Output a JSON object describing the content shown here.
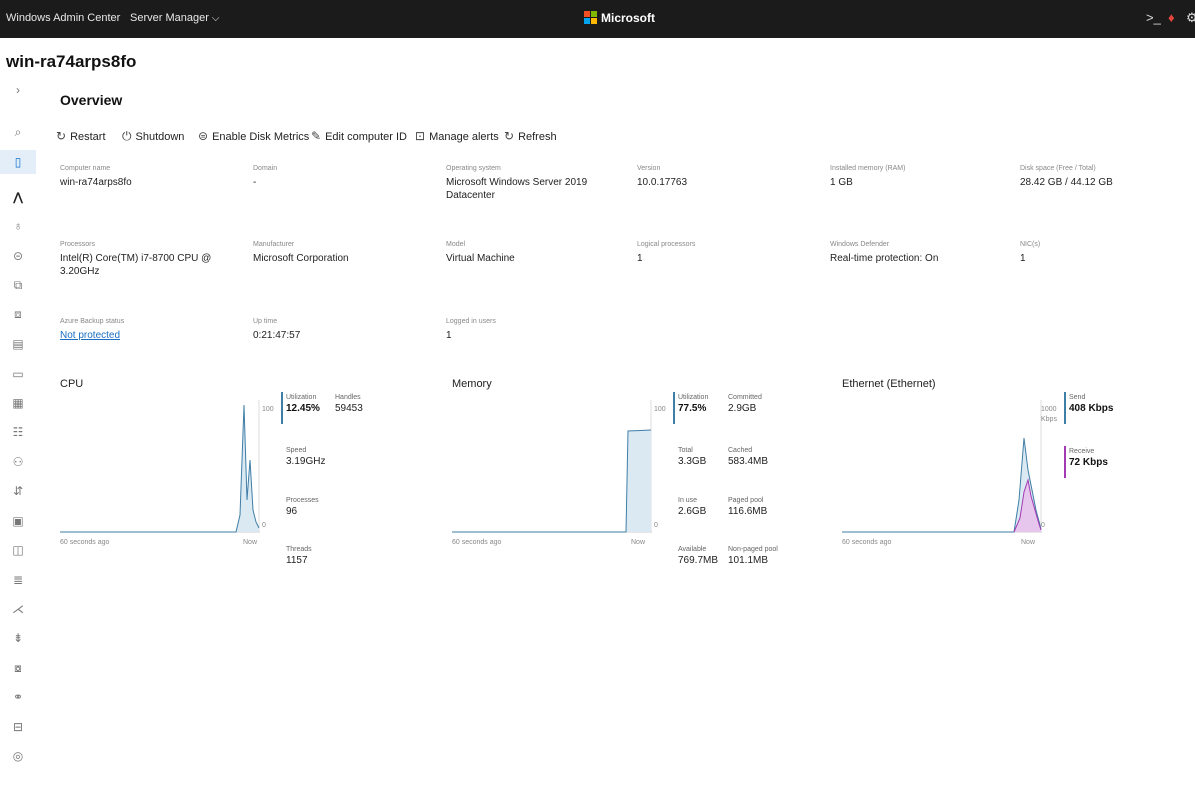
{
  "topbar": {
    "app_title": "Windows Admin Center",
    "server_manager": "Server Manager",
    "brand": "Microsoft",
    "icons": [
      "terminal-icon",
      "notification-icon",
      "settings-icon"
    ]
  },
  "server": {
    "name": "win-ra74arps8fo"
  },
  "page": {
    "title": "Overview"
  },
  "toolbar": {
    "restart": "Restart",
    "shutdown": "Shutdown",
    "enable_disk": "Enable Disk Metrics",
    "edit_id": "Edit computer ID",
    "manage_alerts": "Manage alerts",
    "refresh": "Refresh"
  },
  "props": {
    "computer_name": {
      "label": "Computer name",
      "value": "win-ra74arps8fo"
    },
    "domain": {
      "label": "Domain",
      "value": "-"
    },
    "os": {
      "label": "Operating system",
      "value1": "Microsoft Windows Server 2019",
      "value2": "Datacenter"
    },
    "version": {
      "label": "Version",
      "value": "10.0.17763"
    },
    "memory": {
      "label": "Installed memory (RAM)",
      "value": "1 GB"
    },
    "disk": {
      "label": "Disk space (Free / Total)",
      "value": "28.42 GB / 44.12 GB"
    },
    "processors": {
      "label": "Processors",
      "value1": "Intel(R) Core(TM) i7-8700 CPU @",
      "value2": "3.20GHz"
    },
    "manufacturer": {
      "label": "Manufacturer",
      "value": "Microsoft Corporation"
    },
    "model": {
      "label": "Model",
      "value": "Virtual Machine"
    },
    "logical": {
      "label": "Logical processors",
      "value": "1"
    },
    "defender": {
      "label": "Windows Defender",
      "value": "Real-time protection: On"
    },
    "nics": {
      "label": "NIC(s)",
      "value": "1"
    },
    "backup": {
      "label": "Azure Backup status",
      "value": "Not protected"
    },
    "uptime": {
      "label": "Up time",
      "value": "0:21:47:57"
    },
    "users": {
      "label": "Logged in users",
      "value": "1"
    }
  },
  "cpu": {
    "title": "CPU",
    "max_label": "100",
    "min_label": "0",
    "left_label": "60 seconds ago",
    "right_label": "Now",
    "utilization": {
      "label": "Utilization",
      "value": "12.45%"
    },
    "handles": {
      "label": "Handles",
      "value": "59453"
    },
    "speed": {
      "label": "Speed",
      "value": "3.19GHz"
    },
    "processes": {
      "label": "Processes",
      "value": "96"
    },
    "threads": {
      "label": "Threads",
      "value": "1157"
    }
  },
  "mem": {
    "title": "Memory",
    "max_label": "100",
    "min_label": "0",
    "left_label": "60 seconds ago",
    "right_label": "Now",
    "utilization": {
      "label": "Utilization",
      "value": "77.5%"
    },
    "committed": {
      "label": "Committed",
      "value": "2.9GB"
    },
    "total": {
      "label": "Total",
      "value": "3.3GB"
    },
    "cached": {
      "label": "Cached",
      "value": "583.4MB"
    },
    "inuse": {
      "label": "In use",
      "value": "2.6GB"
    },
    "paged": {
      "label": "Paged pool",
      "value": "116.6MB"
    },
    "available": {
      "label": "Available",
      "value": "769.7MB"
    },
    "nonpaged": {
      "label": "Non-paged pool",
      "value": "101.1MB"
    }
  },
  "eth": {
    "title": "Ethernet (Ethernet)",
    "max_label": "1000",
    "max_unit": "Kbps",
    "min_label": "0",
    "left_label": "60 seconds ago",
    "right_label": "Now",
    "send": {
      "label": "Send",
      "value": "408 Kbps"
    },
    "receive": {
      "label": "Receive",
      "value": "72 Kbps"
    }
  },
  "colors": {
    "accent": "#1170cf",
    "cpu_line": "#3f7ea6",
    "receive": "#a33ab3",
    "send": "#3f7ea6"
  }
}
